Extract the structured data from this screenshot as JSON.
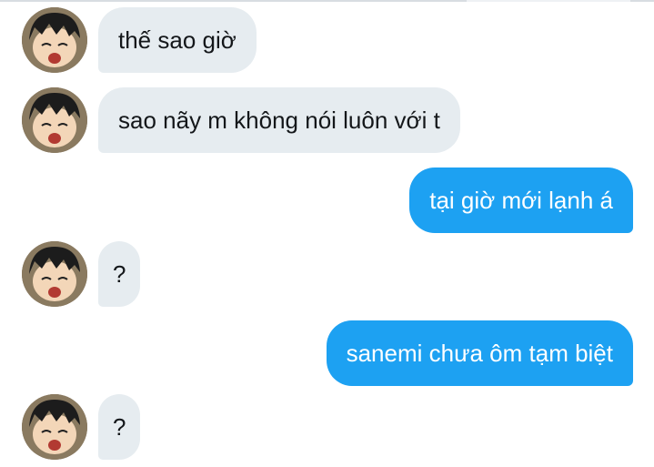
{
  "colors": {
    "incoming_bubble": "#e6ecf0",
    "outgoing_bubble": "#1da1f2",
    "incoming_text": "#14171a",
    "outgoing_text": "#ffffff"
  },
  "avatar_icon": "anime-boy-avatar",
  "messages": [
    {
      "direction": "incoming",
      "text": "thế sao giờ"
    },
    {
      "direction": "incoming",
      "text": "sao nãy m không nói luôn với t"
    },
    {
      "direction": "outgoing",
      "text": "tại giờ mới lạnh á"
    },
    {
      "direction": "incoming",
      "text": "?"
    },
    {
      "direction": "outgoing",
      "text": "sanemi chưa ôm tạm biệt"
    },
    {
      "direction": "incoming",
      "text": "?"
    }
  ]
}
